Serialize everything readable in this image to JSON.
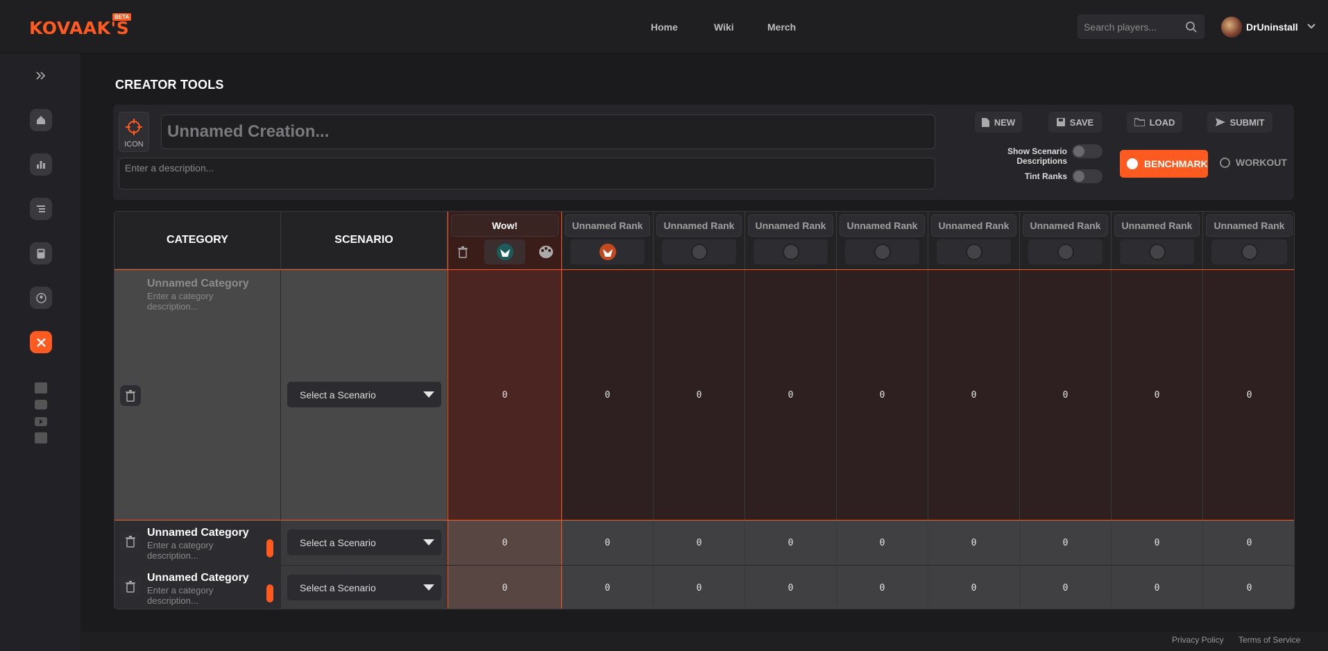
{
  "brand": {
    "logo": "KOVAAK'S",
    "badge": "BETA",
    "accent": "#ff5a1f"
  },
  "nav": {
    "home": "Home",
    "wiki": "Wiki",
    "merch": "Merch"
  },
  "search": {
    "placeholder": "Search players..."
  },
  "user": {
    "name": "DrUninstall"
  },
  "sidebar": {
    "icons": [
      "expand-chevrons-icon",
      "home-icon",
      "bar-chart-icon",
      "list-icon",
      "calculator-icon",
      "profile-icon",
      "creator-tools-icon"
    ],
    "social": [
      "steam-icon",
      "discord-icon",
      "youtube-icon",
      "twitter-icon"
    ]
  },
  "page": {
    "title": "CREATOR TOOLS"
  },
  "creation": {
    "icon_label": "ICON",
    "name_placeholder": "Unnamed Creation...",
    "desc_placeholder": "Enter a description..."
  },
  "actions": {
    "new": "NEW",
    "save": "SAVE",
    "load": "LOAD",
    "submit": "SUBMIT"
  },
  "toggles": {
    "show_desc": "Show Scenario Descriptions",
    "tint_ranks": "Tint Ranks"
  },
  "mode": {
    "benchmark": "BENCHMARK",
    "workout": "WORKOUT",
    "selected": "BENCHMARK"
  },
  "table": {
    "headers": {
      "category": "CATEGORY",
      "scenario": "SCENARIO"
    },
    "ranks": [
      {
        "name": "Wow!",
        "value": "0"
      },
      {
        "name": "Unnamed Rank",
        "value": "0"
      },
      {
        "name": "Unnamed Rank",
        "value": "0"
      },
      {
        "name": "Unnamed Rank",
        "value": "0"
      },
      {
        "name": "Unnamed Rank",
        "value": "0"
      },
      {
        "name": "Unnamed Rank",
        "value": "0"
      },
      {
        "name": "Unnamed Rank",
        "value": "0"
      },
      {
        "name": "Unnamed Rank",
        "value": "0"
      },
      {
        "name": "Unnamed Rank",
        "value": "0"
      }
    ],
    "rows": [
      {
        "category": "Unnamed Category",
        "desc": "Enter a category description...",
        "scenario": "Select a Scenario",
        "values": [
          "0",
          "0",
          "0",
          "0",
          "0",
          "0",
          "0",
          "0",
          "0"
        ]
      },
      {
        "category": "Unnamed Category",
        "desc": "Enter a category description...",
        "scenario": "Select a Scenario",
        "values": [
          "0",
          "0",
          "0",
          "0",
          "0",
          "0",
          "0",
          "0",
          "0"
        ]
      },
      {
        "category": "Unnamed Category",
        "desc": "Enter a category description...",
        "scenario": "Select a Scenario",
        "values": [
          "0",
          "0",
          "0",
          "0",
          "0",
          "0",
          "0",
          "0",
          "0"
        ]
      }
    ]
  },
  "footer": {
    "privacy": "Privacy Policy",
    "terms": "Terms of Service"
  }
}
